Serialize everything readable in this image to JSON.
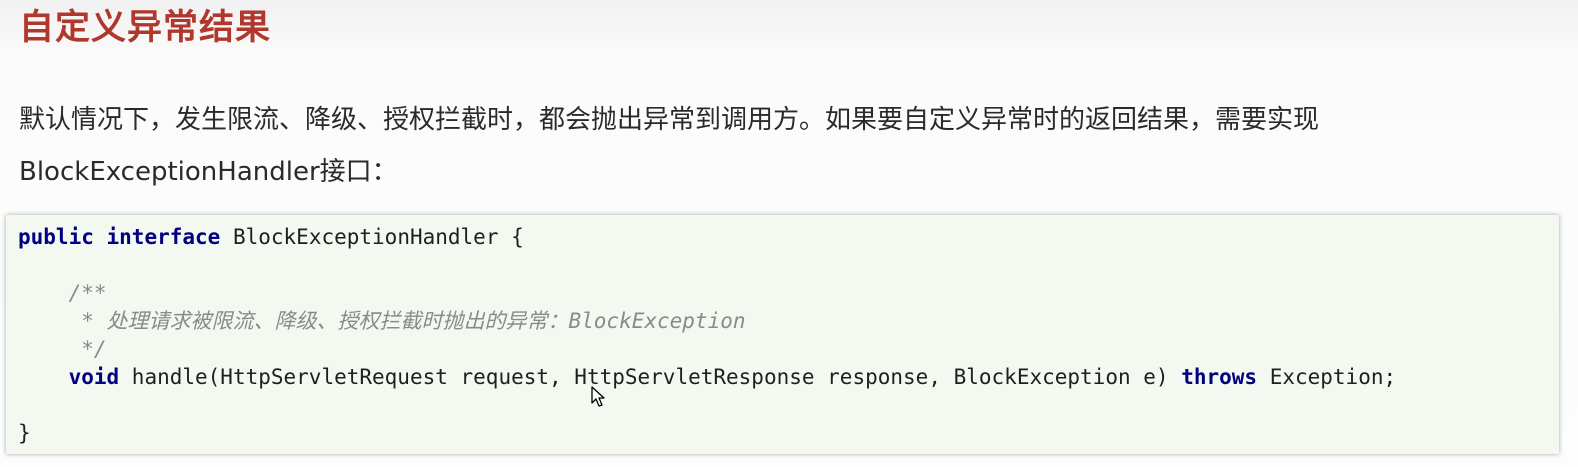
{
  "title": "自定义异常结果",
  "intro": "默认情况下，发生限流、降级、授权拦截时，都会抛出异常到调用方。如果要自定义异常时的返回结果，需要实现BlockExceptionHandler接口：",
  "code": {
    "l1_kw1": "public",
    "l1_kw2": "interface",
    "l1_rest": " BlockExceptionHandler {",
    "c1": "    /**",
    "c2": "     * 处理请求被限流、降级、授权拦截时抛出的异常：BlockException",
    "c3": "     */",
    "l5_indent": "    ",
    "l5_kw": "void",
    "l5_mid": " handle(HttpServletRequest request, HttpServletResponse response, BlockException e) ",
    "l5_kw2": "throws",
    "l5_end": " Exception;",
    "close": "}"
  },
  "icons": {
    "cursor": "mouse-pointer-icon"
  }
}
